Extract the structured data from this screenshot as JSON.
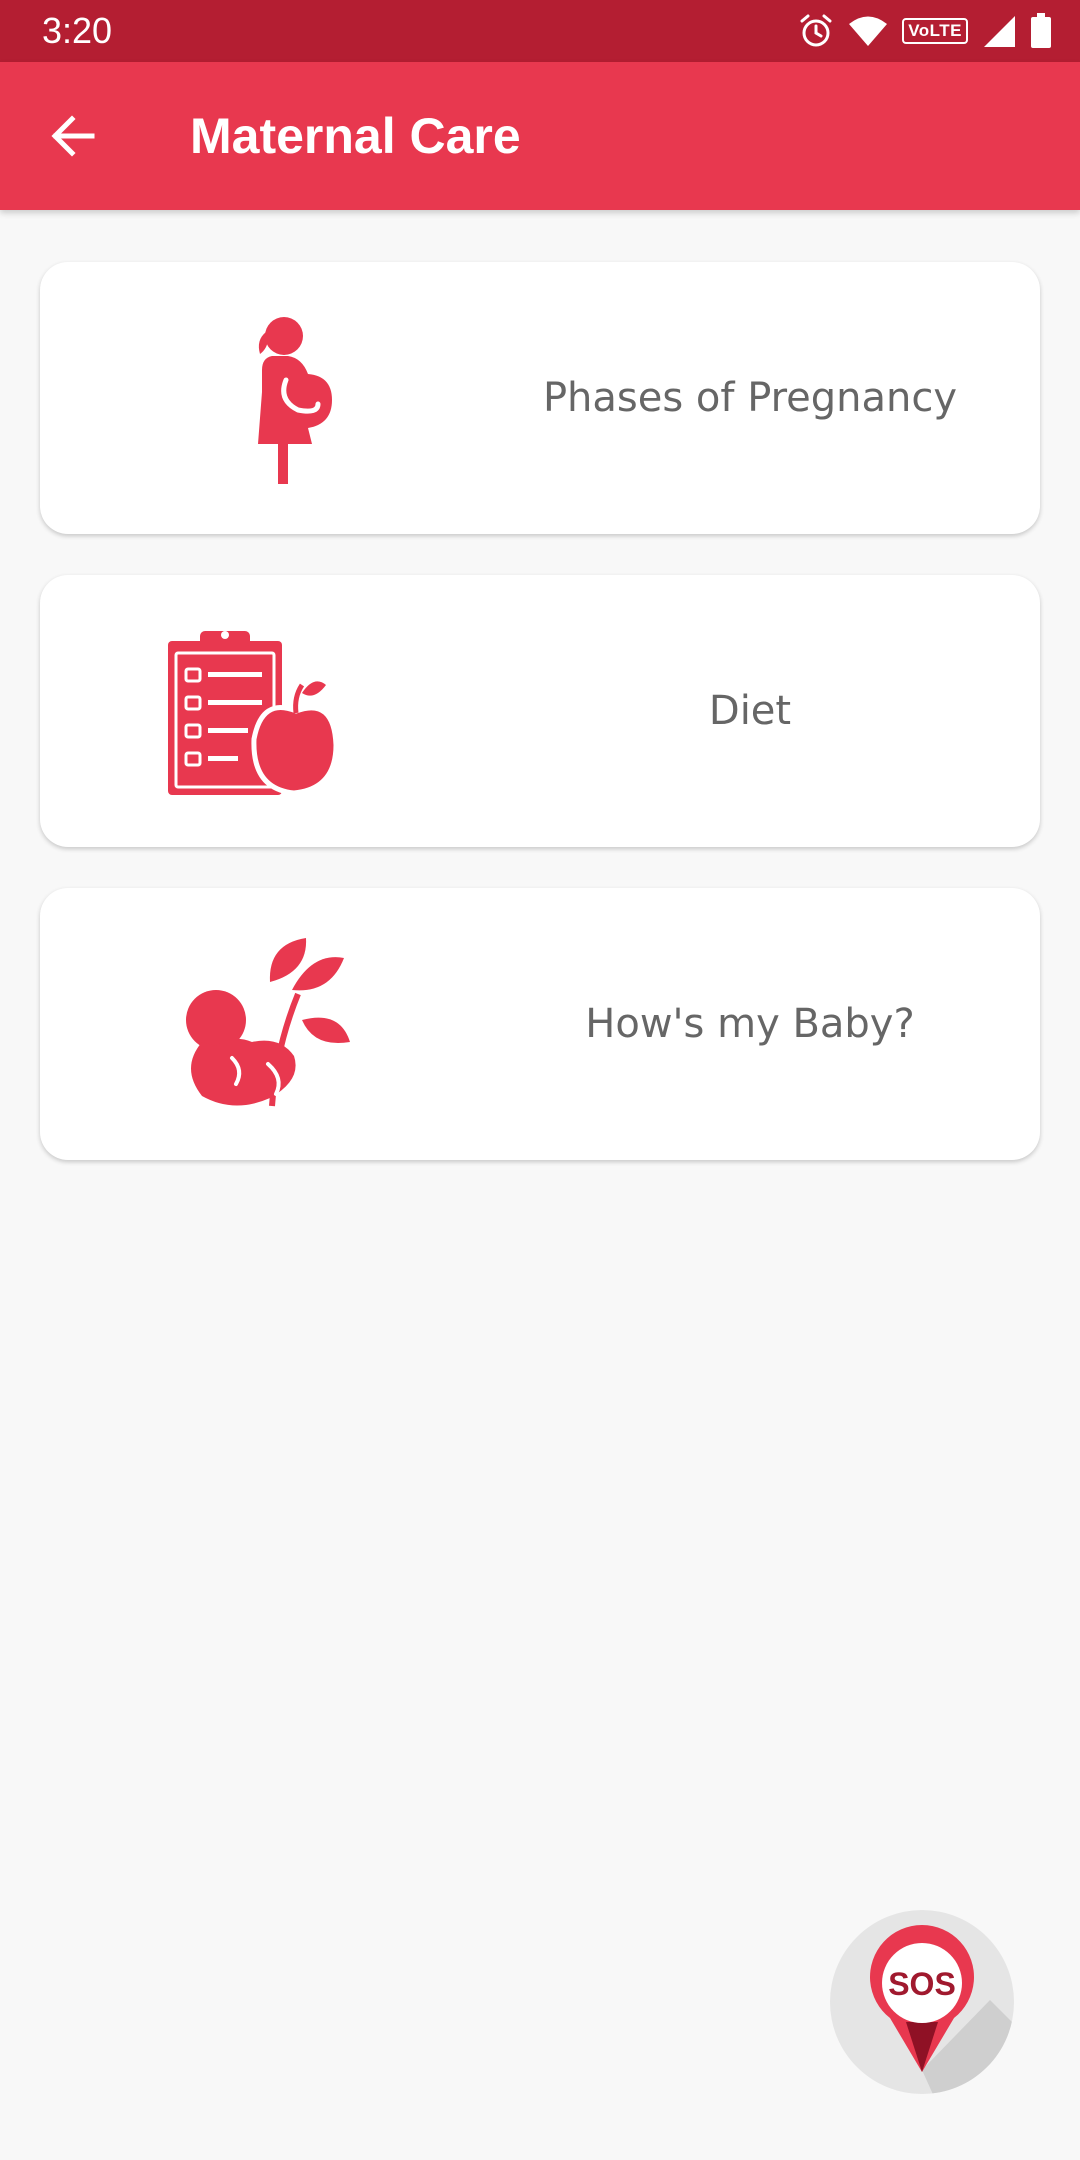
{
  "status_bar": {
    "time": "3:20",
    "network_badge": "VoLTE",
    "icons": [
      "alarm-icon",
      "wifi-icon",
      "volte-icon",
      "signal-icon",
      "battery-icon"
    ]
  },
  "app_bar": {
    "title": "Maternal Care",
    "back_icon": "arrow-left-icon"
  },
  "cards": [
    {
      "label": "Phases of Pregnancy",
      "icon": "pregnant-woman-icon"
    },
    {
      "label": "Diet",
      "icon": "diet-checklist-apple-icon"
    },
    {
      "label": "How's my Baby?",
      "icon": "baby-growth-icon"
    }
  ],
  "fab": {
    "label": "SOS",
    "icon": "sos-location-pin-icon"
  },
  "colors": {
    "status_bar": "#b41e32",
    "app_bar": "#e8384f",
    "accent": "#e8384f",
    "background": "#f8f8f8",
    "card_text": "#666666"
  }
}
